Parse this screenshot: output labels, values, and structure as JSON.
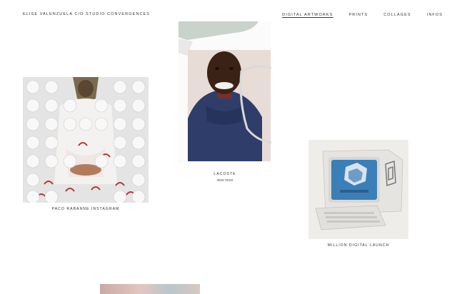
{
  "header": {
    "site_title": "ELISE VALENZUELA C/O STUDIO CONVERGENCES",
    "nav": [
      {
        "label": "DIGITAL ARTWORKS",
        "active": true
      },
      {
        "label": "PRINTS",
        "active": false
      },
      {
        "label": "COLLAGES",
        "active": false
      },
      {
        "label": "INFOS",
        "active": false
      }
    ]
  },
  "works": [
    {
      "caption": "PACO RABANNE INSTAGRAM"
    },
    {
      "caption": "LACOSTE",
      "link": "view more"
    },
    {
      "caption": "MILLION DIGITAL LAUNCH"
    }
  ],
  "colors": {
    "background": "#ffffff",
    "text": "#333333",
    "hoodie": "#2f3d6b",
    "screen": "#3a7fb8"
  }
}
